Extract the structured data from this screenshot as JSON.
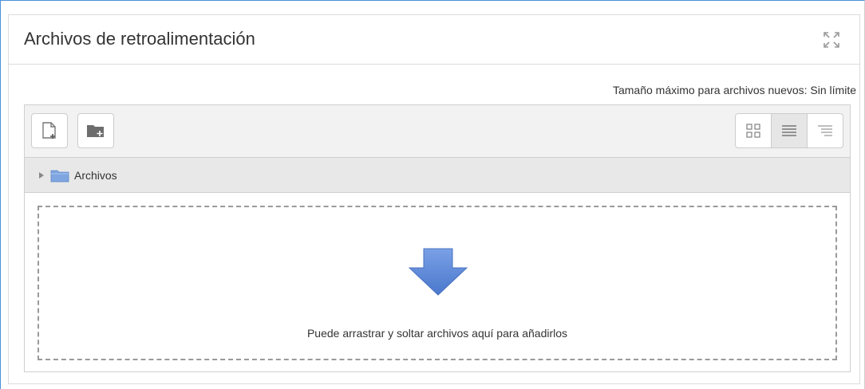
{
  "card": {
    "title": "Archivos de retroalimentación",
    "expand_icon": "expand-icon"
  },
  "filemanager": {
    "max_size_label": "Tamaño máximo para archivos nuevos: Sin límite",
    "toolbar": {
      "add_file_icon": "add-file-icon",
      "create_folder_icon": "create-folder-icon",
      "views": [
        {
          "icon": "grid-view-icon",
          "active": false
        },
        {
          "icon": "list-view-icon",
          "active": true
        },
        {
          "icon": "tree-view-icon",
          "active": false
        }
      ]
    },
    "path": {
      "folder_label": "Archivos",
      "folder_color": "#7fa6e0"
    },
    "dropzone": {
      "text": "Puede arrastrar y soltar archivos aquí para añadirlos",
      "arrow_color": "#5b86d6"
    }
  }
}
